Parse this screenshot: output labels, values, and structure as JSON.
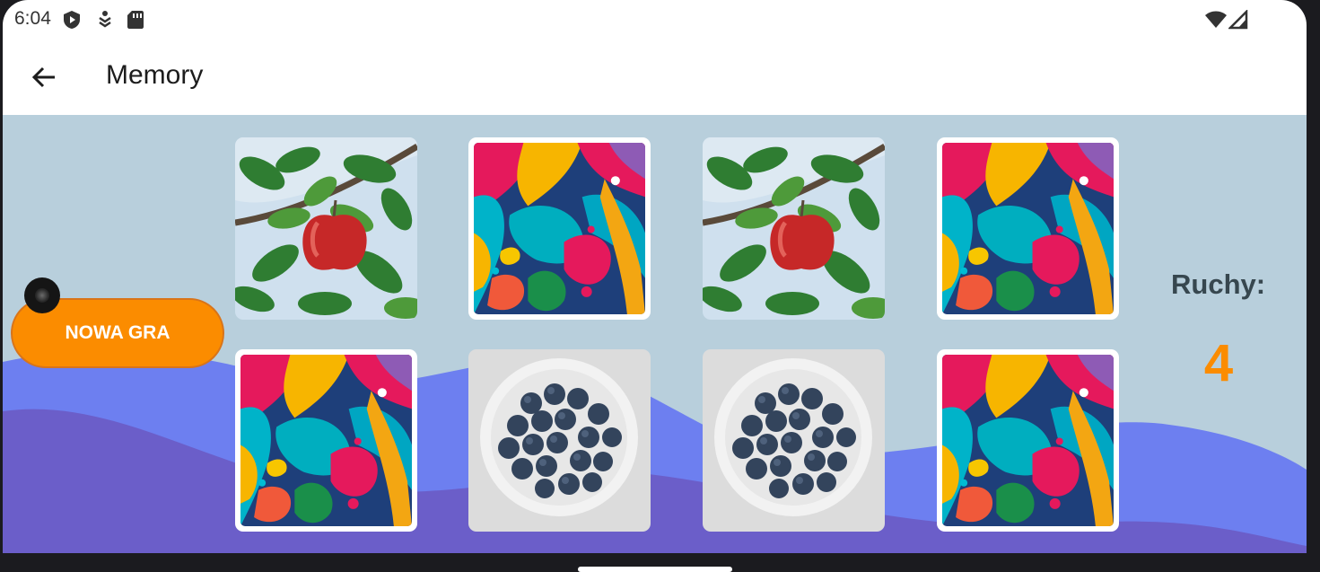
{
  "status_bar": {
    "time": "6:04"
  },
  "app_bar": {
    "title": "Memory"
  },
  "game": {
    "new_game_label": "NOWA GRA",
    "moves_label": "Ruchy:",
    "moves_value": "4",
    "cards": [
      {
        "face": "apple",
        "revealed": true
      },
      {
        "face": "hidden",
        "revealed": false
      },
      {
        "face": "apple",
        "revealed": true
      },
      {
        "face": "hidden",
        "revealed": false
      },
      {
        "face": "hidden",
        "revealed": false
      },
      {
        "face": "blueberries",
        "revealed": true
      },
      {
        "face": "blueberries",
        "revealed": true
      },
      {
        "face": "hidden",
        "revealed": false
      }
    ]
  },
  "colors": {
    "accent": "#fb8c00",
    "background": "#b8cfdc",
    "wave": "#6d7ff0"
  }
}
